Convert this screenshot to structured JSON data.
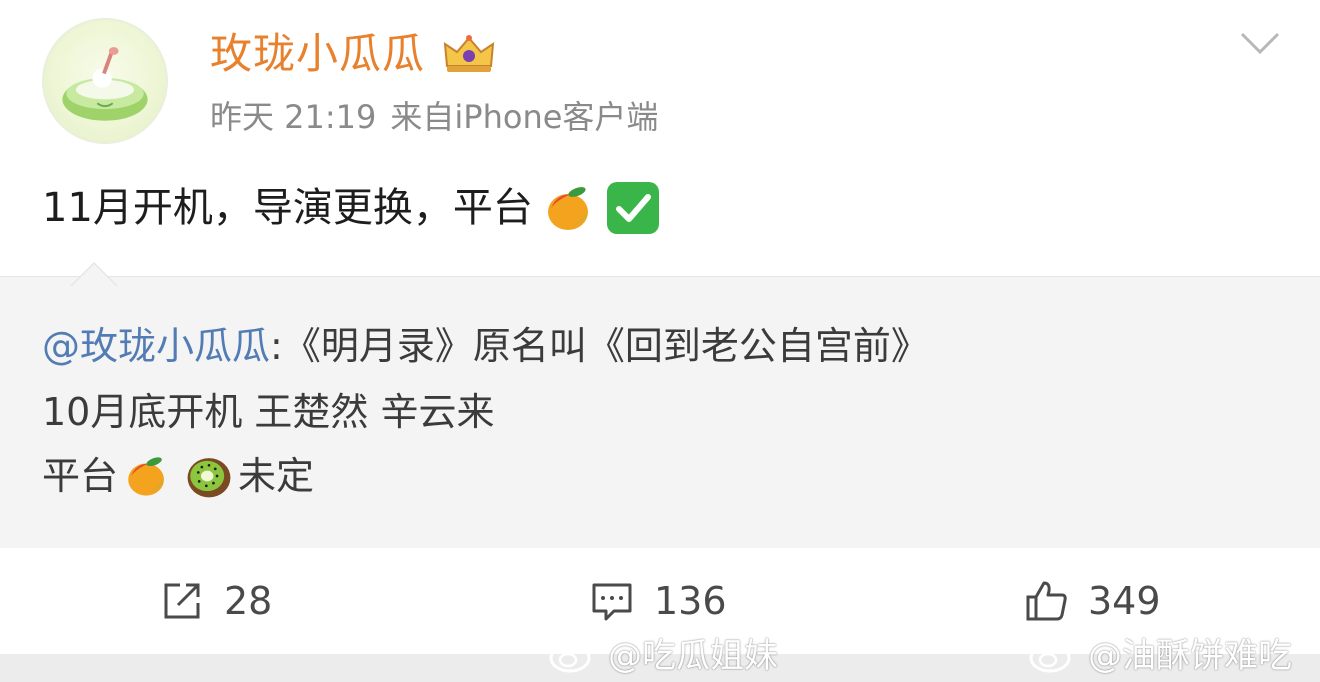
{
  "post": {
    "username": "玫珑小瓜瓜",
    "time": "昨天 21:19",
    "source": "来自iPhone客户端",
    "content_text": "11月开机，导演更换，平台",
    "content_emojis": [
      "mango-emoji",
      "check-mark-emoji"
    ]
  },
  "repost": {
    "mention": "@玫珑小瓜瓜",
    "line1_text": ":《明月录》原名叫《回到老公自宫前》",
    "line2_text": "10月底开机 王楚然 辛云来",
    "line3_prefix": "平台",
    "line3_emojis": [
      "mango-emoji",
      "kiwi-emoji"
    ],
    "line3_suffix": "未定"
  },
  "actions": {
    "repost_count": "28",
    "comment_count": "136",
    "like_count": "349"
  },
  "watermarks": [
    "@吃瓜姐妹",
    "@油酥饼难吃"
  ],
  "colors": {
    "username": "#e8812e",
    "mention": "#527cb3",
    "meta": "#8a8a8a",
    "repost_bg": "#f4f4f4"
  }
}
